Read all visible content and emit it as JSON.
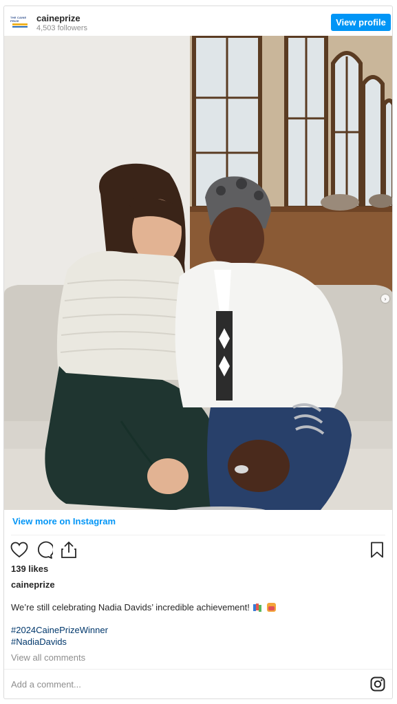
{
  "header": {
    "username": "caineprize",
    "followers": "4,503 followers",
    "view_profile_label": "View profile",
    "logo_text": "THE CAINE PRIZE"
  },
  "photo": {
    "alt": "Two women smiling, seated together on a grey bench in a wood-panelled room with tall arched windows"
  },
  "view_more_label": "View more on Instagram",
  "actions": {
    "icons": [
      "heart-icon",
      "comment-icon",
      "share-icon",
      "bookmark-icon"
    ]
  },
  "likes": "139 likes",
  "caption": {
    "username": "caineprize",
    "text": "We’re still celebrating Nadia Davids’ incredible achievement!",
    "hashtags": [
      "#2024CainePrizeWinner",
      "#NadiaDavids"
    ]
  },
  "view_all_comments": "View all comments",
  "comment_placeholder": "Add a comment...",
  "colors": {
    "accent": "#0095f6",
    "hashtag": "#00376b",
    "muted": "#8e8e8e"
  }
}
